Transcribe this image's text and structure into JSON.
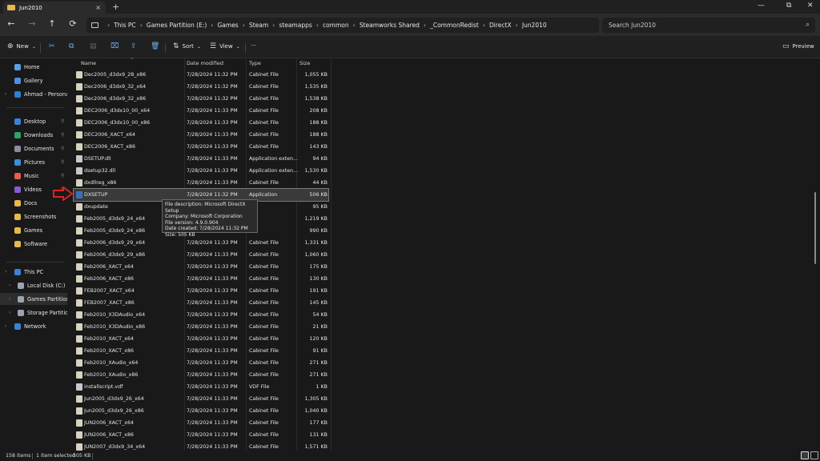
{
  "window": {
    "tab_title": "Jun2010",
    "new_tab": "+",
    "tab_close": "×",
    "minimize": "—",
    "maximize": "⧉",
    "close": "✕"
  },
  "nav": {
    "back": "←",
    "forward": "→",
    "up": "↑",
    "refresh": "⟳"
  },
  "breadcrumbs": [
    "This PC",
    "Games Partition (E:)",
    "Games",
    "Steam",
    "steamapps",
    "common",
    "Steamworks Shared",
    "_CommonRedist",
    "DirectX",
    "Jun2010"
  ],
  "search": {
    "placeholder": "Search Jun2010",
    "value": ""
  },
  "toolbar": {
    "new_label": "New",
    "sort_label": "Sort",
    "view_label": "View",
    "more_label": "···",
    "preview_label": "Preview"
  },
  "sidebar": {
    "quick": [
      {
        "label": "Home",
        "color": "#5aa0e6"
      },
      {
        "label": "Gallery",
        "color": "#4f8fe0"
      },
      {
        "label": "Ahmad - Personal",
        "color": "#2f7fd6"
      }
    ],
    "pinned": [
      {
        "label": "Desktop",
        "color": "#3b82d6"
      },
      {
        "label": "Downloads",
        "color": "#2fa36b"
      },
      {
        "label": "Documents",
        "color": "#8a8fa0"
      },
      {
        "label": "Pictures",
        "color": "#3b8fd6"
      },
      {
        "label": "Music",
        "color": "#e0604a"
      },
      {
        "label": "Videos",
        "color": "#8a5ad6"
      },
      {
        "label": "Docs",
        "color": "#e8b84a"
      },
      {
        "label": "Screenshots",
        "color": "#e8b84a"
      },
      {
        "label": "Games",
        "color": "#e8b84a"
      },
      {
        "label": "Software",
        "color": "#e8b84a"
      }
    ],
    "tree": [
      {
        "label": "This PC",
        "color": "#3b82d6"
      },
      {
        "label": "Local Disk (C:)",
        "color": "#9aa4b0"
      },
      {
        "label": "Games Partition (E:)",
        "color": "#9aa4b0"
      },
      {
        "label": "Storage Partition (D:)",
        "color": "#9aa4b0"
      },
      {
        "label": "Network",
        "color": "#3b82d6"
      }
    ]
  },
  "columns": {
    "name": "Name",
    "date": "Date modified",
    "type": "Type",
    "size": "Size"
  },
  "files": [
    {
      "name": "Dec2005_d3dx9_28_x86",
      "date": "7/28/2024 11:32 PM",
      "type": "Cabinet File",
      "size": "1,055 KB",
      "icon": "cab"
    },
    {
      "name": "Dec2006_d3dx9_32_x64",
      "date": "7/28/2024 11:32 PM",
      "type": "Cabinet File",
      "size": "1,535 KB",
      "icon": "cab"
    },
    {
      "name": "Dec2006_d3dx9_32_x86",
      "date": "7/28/2024 11:32 PM",
      "type": "Cabinet File",
      "size": "1,538 KB",
      "icon": "cab"
    },
    {
      "name": "DEC2006_d3dx10_00_x64",
      "date": "7/28/2024 11:33 PM",
      "type": "Cabinet File",
      "size": "208 KB",
      "icon": "cab"
    },
    {
      "name": "DEC2006_d3dx10_00_x86",
      "date": "7/28/2024 11:33 PM",
      "type": "Cabinet File",
      "size": "188 KB",
      "icon": "cab"
    },
    {
      "name": "DEC2006_XACT_x64",
      "date": "7/28/2024 11:33 PM",
      "type": "Cabinet File",
      "size": "188 KB",
      "icon": "cab"
    },
    {
      "name": "DEC2006_XACT_x86",
      "date": "7/28/2024 11:33 PM",
      "type": "Cabinet File",
      "size": "143 KB",
      "icon": "cab"
    },
    {
      "name": "DSETUP.dll",
      "date": "7/28/2024 11:33 PM",
      "type": "Application exten...",
      "size": "94 KB",
      "icon": "dll"
    },
    {
      "name": "dsetup32.dll",
      "date": "7/28/2024 11:33 PM",
      "type": "Application exten...",
      "size": "1,530 KB",
      "icon": "dll"
    },
    {
      "name": "dxdllreg_x86",
      "date": "7/28/2024 11:33 PM",
      "type": "Cabinet File",
      "size": "44 KB",
      "icon": "cab"
    },
    {
      "name": "DXSETUP",
      "date": "7/28/2024 11:32 PM",
      "type": "Application",
      "size": "506 KB",
      "icon": "app",
      "selected": true
    },
    {
      "name": "dxupdate",
      "date": "",
      "type": "",
      "size": "95 KB",
      "icon": "cab"
    },
    {
      "name": "Feb2005_d3dx9_24_x64",
      "date": "",
      "type": "",
      "size": "1,219 KB",
      "icon": "cab"
    },
    {
      "name": "Feb2005_d3dx9_24_x86",
      "date": "",
      "type": "",
      "size": "990 KB",
      "icon": "cab"
    },
    {
      "name": "Feb2006_d3dx9_29_x64",
      "date": "7/28/2024 11:33 PM",
      "type": "Cabinet File",
      "size": "1,331 KB",
      "icon": "cab"
    },
    {
      "name": "Feb2006_d3dx9_29_x86",
      "date": "7/28/2024 11:33 PM",
      "type": "Cabinet File",
      "size": "1,060 KB",
      "icon": "cab"
    },
    {
      "name": "Feb2006_XACT_x64",
      "date": "7/28/2024 11:33 PM",
      "type": "Cabinet File",
      "size": "175 KB",
      "icon": "cab"
    },
    {
      "name": "Feb2006_XACT_x86",
      "date": "7/28/2024 11:33 PM",
      "type": "Cabinet File",
      "size": "130 KB",
      "icon": "cab"
    },
    {
      "name": "FEB2007_XACT_x64",
      "date": "7/28/2024 11:33 PM",
      "type": "Cabinet File",
      "size": "191 KB",
      "icon": "cab"
    },
    {
      "name": "FEB2007_XACT_x86",
      "date": "7/28/2024 11:33 PM",
      "type": "Cabinet File",
      "size": "145 KB",
      "icon": "cab"
    },
    {
      "name": "Feb2010_X3DAudio_x64",
      "date": "7/28/2024 11:33 PM",
      "type": "Cabinet File",
      "size": "54 KB",
      "icon": "cab"
    },
    {
      "name": "Feb2010_X3DAudio_x86",
      "date": "7/28/2024 11:33 PM",
      "type": "Cabinet File",
      "size": "21 KB",
      "icon": "cab"
    },
    {
      "name": "Feb2010_XACT_x64",
      "date": "7/28/2024 11:33 PM",
      "type": "Cabinet File",
      "size": "120 KB",
      "icon": "cab"
    },
    {
      "name": "Feb2010_XACT_x86",
      "date": "7/28/2024 11:33 PM",
      "type": "Cabinet File",
      "size": "91 KB",
      "icon": "cab"
    },
    {
      "name": "Feb2010_XAudio_x64",
      "date": "7/28/2024 11:33 PM",
      "type": "Cabinet File",
      "size": "271 KB",
      "icon": "cab"
    },
    {
      "name": "Feb2010_XAudio_x86",
      "date": "7/28/2024 11:33 PM",
      "type": "Cabinet File",
      "size": "271 KB",
      "icon": "cab"
    },
    {
      "name": "installscript.vdf",
      "date": "7/28/2024 11:33 PM",
      "type": "VDF File",
      "size": "1 KB",
      "icon": "txt"
    },
    {
      "name": "Jun2005_d3dx9_26_x64",
      "date": "7/28/2024 11:33 PM",
      "type": "Cabinet File",
      "size": "1,305 KB",
      "icon": "cab"
    },
    {
      "name": "Jun2005_d3dx9_26_x86",
      "date": "7/28/2024 11:33 PM",
      "type": "Cabinet File",
      "size": "1,040 KB",
      "icon": "cab"
    },
    {
      "name": "JUN2006_XACT_x64",
      "date": "7/28/2024 11:33 PM",
      "type": "Cabinet File",
      "size": "177 KB",
      "icon": "cab"
    },
    {
      "name": "JUN2006_XACT_x86",
      "date": "7/28/2024 11:33 PM",
      "type": "Cabinet File",
      "size": "131 KB",
      "icon": "cab"
    },
    {
      "name": "JUN2007_d3dx9_34_x64",
      "date": "7/28/2024 11:33 PM",
      "type": "Cabinet File",
      "size": "1,571 KB",
      "icon": "cab"
    }
  ],
  "tooltip": {
    "lines": [
      "File description: Microsoft DirectX Setup",
      "Company: Microsoft Corporation",
      "File version: 4.9.0.904",
      "Date created: 7/28/2024 11:32 PM",
      "Size: 505 KB"
    ]
  },
  "status": {
    "item_count": "158 items",
    "selected": "1 item selected",
    "selected_size": "505 KB"
  },
  "colors": {
    "accent": "#e02020",
    "folder": "#e8b84a"
  }
}
